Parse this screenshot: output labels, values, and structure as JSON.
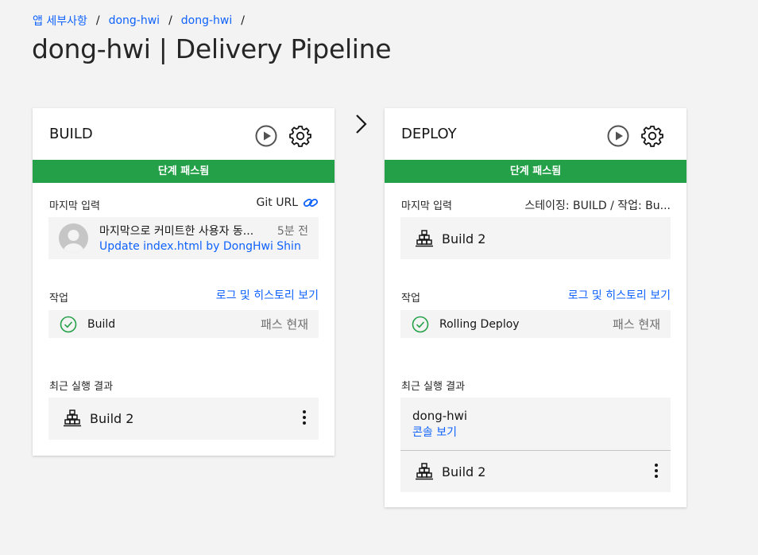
{
  "breadcrumb": {
    "items": [
      "앱 세부사항",
      "dong-hwi",
      "dong-hwi"
    ],
    "separator": "/"
  },
  "page_title": "dong-hwi | Delivery Pipeline",
  "colors": {
    "success": "#24a148",
    "link": "#0f62fe",
    "tile": "#f4f4f4"
  },
  "build_stage": {
    "title": "BUILD",
    "status": "단계 패스됨",
    "last_input": {
      "label": "마지막 입력",
      "source": "Git URL",
      "commit_message": "마지막으로 커미트한 사용자 동...",
      "commit_time": "5분 전",
      "commit_link": "Update index.html by DongHwi Shin"
    },
    "jobs": {
      "label": "작업",
      "link": "로그 및 히스토리 보기",
      "items": [
        {
          "name": "Build",
          "status": "패스 현재",
          "icon": "check-circle-icon"
        }
      ]
    },
    "recent": {
      "label": "최근 실행 결과",
      "build": "Build 2"
    }
  },
  "deploy_stage": {
    "title": "DEPLOY",
    "status": "단계 패스됨",
    "last_input": {
      "label": "마지막 입력",
      "source": "스테이징: BUILD  /  작업: Bu...",
      "build": "Build 2"
    },
    "jobs": {
      "label": "작업",
      "link": "로그 및 히스토리 보기",
      "items": [
        {
          "name": "Rolling Deploy",
          "status": "패스 현재",
          "icon": "check-circle-icon"
        }
      ]
    },
    "recent": {
      "label": "최근 실행 결과",
      "app_name": "dong-hwi",
      "console_link": "콘솔 보기",
      "build": "Build 2"
    }
  }
}
